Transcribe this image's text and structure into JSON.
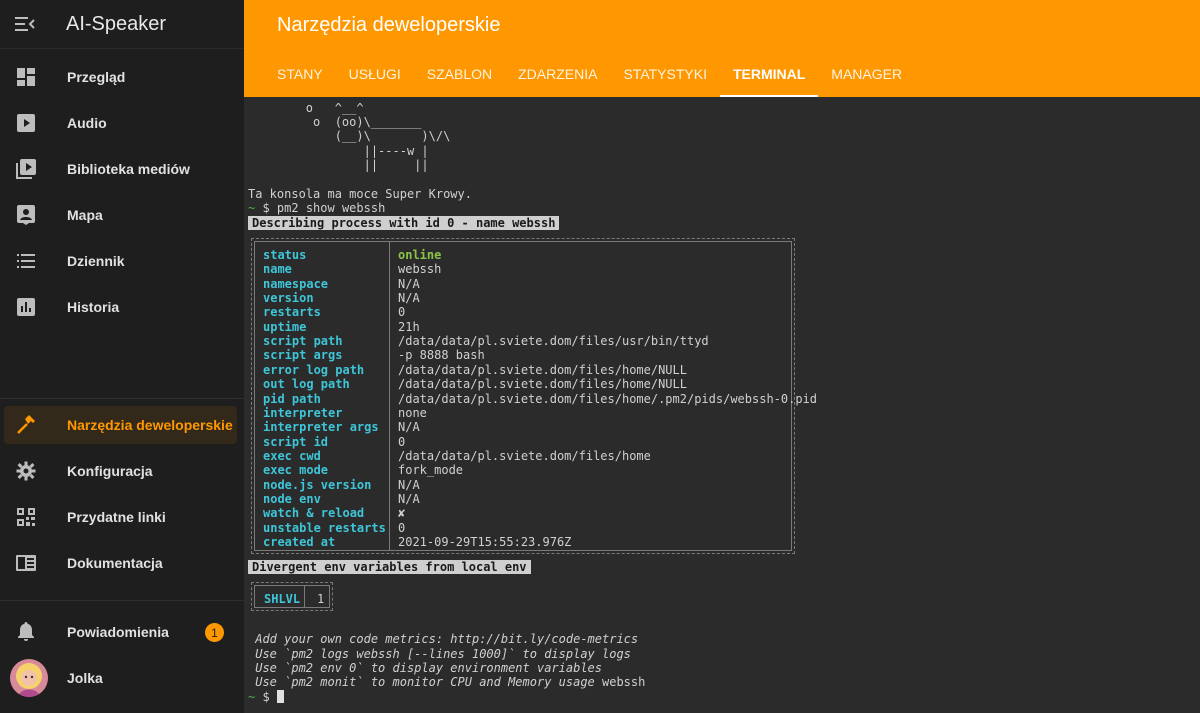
{
  "app": {
    "title": "AI-Speaker"
  },
  "sidebar": {
    "items": [
      {
        "label": "Przegląd",
        "icon": "dashboard-icon"
      },
      {
        "label": "Audio",
        "icon": "play-icon"
      },
      {
        "label": "Biblioteka mediów",
        "icon": "media-library-icon"
      },
      {
        "label": "Mapa",
        "icon": "map-person-icon"
      },
      {
        "label": "Dziennik",
        "icon": "list-icon"
      },
      {
        "label": "Historia",
        "icon": "chart-icon"
      }
    ],
    "tools": [
      {
        "label": "Narzędzia deweloperskie",
        "icon": "hammer-icon",
        "active": true
      },
      {
        "label": "Konfiguracja",
        "icon": "gear-icon"
      },
      {
        "label": "Przydatne linki",
        "icon": "qr-icon"
      },
      {
        "label": "Dokumentacja",
        "icon": "book-icon"
      }
    ],
    "notifications": {
      "label": "Powiadomienia",
      "count": "1"
    },
    "user": {
      "name": "Jolka"
    }
  },
  "header": {
    "title": "Narzędzia deweloperskie",
    "tabs": [
      "STANY",
      "USŁUGI",
      "SZABLON",
      "ZDARZENIA",
      "STATYSTYKI",
      "TERMINAL",
      "MANAGER"
    ],
    "active_tab": "TERMINAL"
  },
  "terminal": {
    "cow": [
      "        o   ^__^",
      "         o  (oo)\\_______",
      "            (__)\\       )\\/\\",
      "                ||----w |",
      "                ||     ||"
    ],
    "motd": "Ta konsola ma moce Super Krowy.",
    "prompt": "~",
    "command": "$ pm2 show webssh",
    "describe_header": "Describing process with id 0 - name webssh",
    "process": [
      {
        "key": "status",
        "value": "online"
      },
      {
        "key": "name",
        "value": "webssh"
      },
      {
        "key": "namespace",
        "value": "N/A"
      },
      {
        "key": "version",
        "value": "N/A"
      },
      {
        "key": "restarts",
        "value": "0"
      },
      {
        "key": "uptime",
        "value": "21h"
      },
      {
        "key": "script path",
        "value": "/data/data/pl.sviete.dom/files/usr/bin/ttyd"
      },
      {
        "key": "script args",
        "value": "-p 8888 bash"
      },
      {
        "key": "error log path",
        "value": "/data/data/pl.sviete.dom/files/home/NULL"
      },
      {
        "key": "out log path",
        "value": "/data/data/pl.sviete.dom/files/home/NULL"
      },
      {
        "key": "pid path",
        "value": "/data/data/pl.sviete.dom/files/home/.pm2/pids/webssh-0.pid"
      },
      {
        "key": "interpreter",
        "value": "none"
      },
      {
        "key": "interpreter args",
        "value": "N/A"
      },
      {
        "key": "script id",
        "value": "0"
      },
      {
        "key": "exec cwd",
        "value": "/data/data/pl.sviete.dom/files/home"
      },
      {
        "key": "exec mode",
        "value": "fork_mode"
      },
      {
        "key": "node.js version",
        "value": "N/A"
      },
      {
        "key": "node env",
        "value": "N/A"
      },
      {
        "key": "watch & reload",
        "value": "✘"
      },
      {
        "key": "unstable restarts",
        "value": "0"
      },
      {
        "key": "created at",
        "value": "2021-09-29T15:55:23.976Z"
      }
    ],
    "env_header": "Divergent env variables from local env",
    "env": {
      "key": "SHLVL",
      "value": "1"
    },
    "hints": [
      " Add your own code metrics: http://bit.ly/code-metrics",
      " Use `pm2 logs webssh [--lines 1000]` to display logs",
      " Use `pm2 env 0` to display environment variables"
    ],
    "hint_last": " Use `pm2 monit` to monitor CPU and Memory usage",
    "hint_last_suffix": " webssh",
    "final_prompt": "$ "
  },
  "colors": {
    "accent": "#ff9800",
    "key_cyan": "#3ec6d8",
    "online_green": "#8bc34a"
  }
}
